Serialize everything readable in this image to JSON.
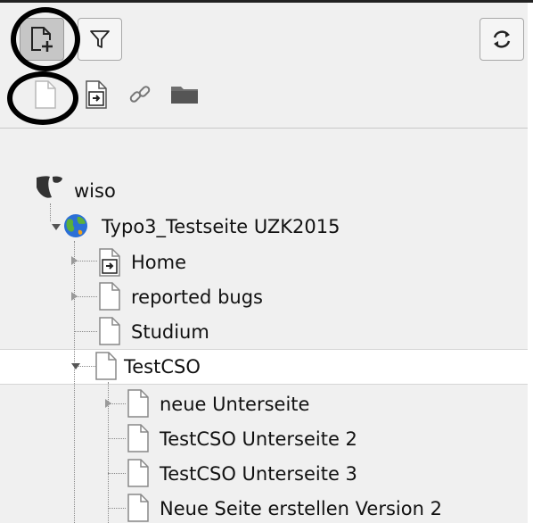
{
  "toolbar": {
    "new_page_icon": "page-add-icon",
    "filter_icon": "filter-icon",
    "refresh_icon": "refresh-icon"
  },
  "drag_icons": [
    "page-icon",
    "page-shortcut-icon",
    "link-icon",
    "folder-icon"
  ],
  "tree": {
    "root_label": "wiso",
    "site_label": "Typo3_Testseite UZK2015",
    "items": [
      {
        "label": "Home",
        "icon": "page-shortcut-icon"
      },
      {
        "label": "reported bugs",
        "icon": "page-icon"
      },
      {
        "label": "Studium",
        "icon": "page-icon"
      },
      {
        "label": "TestCSO",
        "icon": "page-icon"
      }
    ],
    "children": [
      {
        "label": "neue Unterseite",
        "icon": "page-icon"
      },
      {
        "label": "TestCSO Unterseite 2",
        "icon": "page-icon"
      },
      {
        "label": "TestCSO Unterseite 3",
        "icon": "page-icon"
      },
      {
        "label": "Neue Seite erstellen Version 2",
        "icon": "page-icon"
      }
    ]
  },
  "colors": {
    "annotation": "#000000",
    "selected_row": "#ffffff",
    "background": "#f0f0f0"
  }
}
